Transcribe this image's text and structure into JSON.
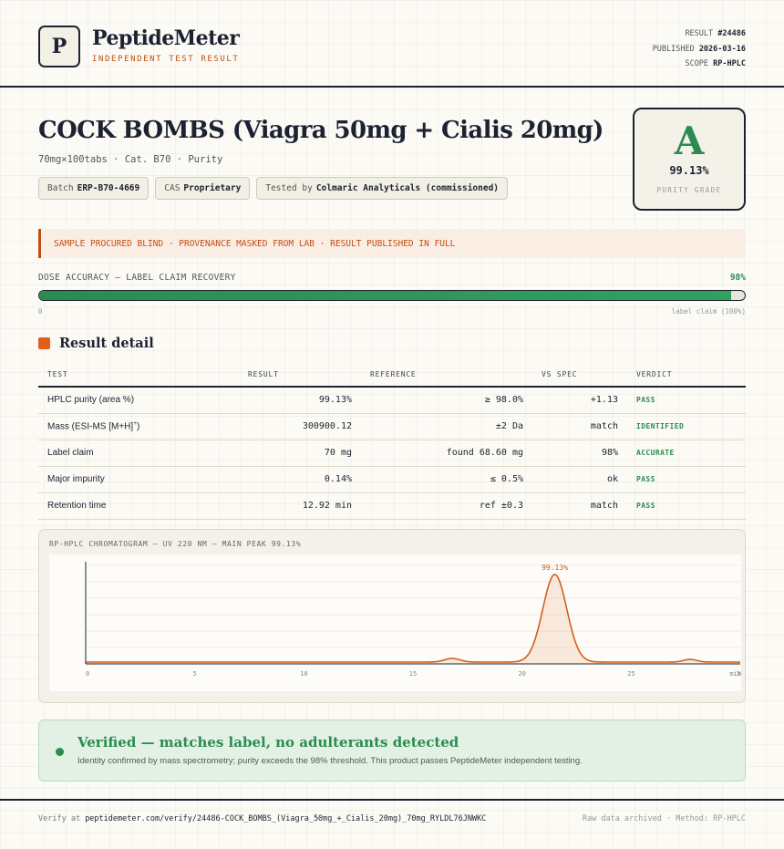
{
  "header": {
    "logo_letter": "P",
    "brand": "PeptideMeter",
    "brand_sub": "INDEPENDENT TEST RESULT",
    "result_label": "RESULT",
    "result_value": "#24486",
    "published_label": "PUBLISHED",
    "published_value": "2026-03-16",
    "scope_label": "SCOPE",
    "scope_value": "RP-HPLC"
  },
  "product": {
    "title": "COCK BOMBS (Viagra 50mg + Cialis 20mg)",
    "subtitle": "70mg×100tabs · Cat. B70 · Purity",
    "chips": [
      {
        "label": "Batch",
        "value": "ERP-B70-4669"
      },
      {
        "label": "CAS",
        "value": "Proprietary"
      },
      {
        "label": "Tested by",
        "value": "Colmaric Analyticals (commissioned)"
      }
    ]
  },
  "grade": {
    "letter": "A",
    "percent": "99.13%",
    "label": "PURITY GRADE"
  },
  "notice": "SAMPLE PROCURED BLIND · PROVENANCE MASKED FROM LAB · RESULT PUBLISHED IN FULL",
  "dose": {
    "label": "DOSE ACCURACY — LABEL CLAIM RECOVERY",
    "value_text": "98%",
    "fraction": 0.98,
    "min_label": "0",
    "max_label": "label claim (100%)"
  },
  "results": {
    "section_title": "Result detail",
    "headers": [
      "TEST",
      "RESULT",
      "REFERENCE",
      "VS SPEC",
      "VERDICT"
    ],
    "rows": [
      {
        "test": "HPLC purity (area %)",
        "result": "99.13%",
        "reference": "≥ 98.0%",
        "vs_spec": "+1.13",
        "verdict": "PASS"
      },
      {
        "test": "Mass (ESI-MS [M+H]",
        "test_sup": "+",
        "test_end": ")",
        "result": "300900.12",
        "reference": "±2 Da",
        "vs_spec": "match",
        "verdict": "IDENTIFIED"
      },
      {
        "test": "Label claim",
        "result": "70 mg",
        "reference": "found 68.60 mg",
        "vs_spec": "98%",
        "verdict": "ACCURATE"
      },
      {
        "test": "Major impurity",
        "result": "0.14%",
        "reference": "≤ 0.5%",
        "vs_spec": "ok",
        "verdict": "PASS"
      },
      {
        "test": "Retention time",
        "result": "12.92 min",
        "reference": "ref ±0.3",
        "vs_spec": "match",
        "verdict": "PASS"
      }
    ]
  },
  "chromatogram": {
    "title": "RP-HPLC CHROMATOGRAM — UV 220 NM — MAIN PEAK 99.13%",
    "peak_label": "99.13%",
    "accent": "#d4601a"
  },
  "chart_data": {
    "type": "line",
    "title": "RP-HPLC CHROMATOGRAM — UV 220 NM — MAIN PEAK 99.13%",
    "x_ticks": [
      "0",
      "5",
      "10",
      "15",
      "20",
      "25",
      "30"
    ],
    "x_end_label": "min",
    "xlim": [
      0,
      30
    ],
    "series": [
      {
        "x": [
          0,
          16,
          16.8,
          17.6,
          19.5,
          20.3,
          21.0,
          21.5,
          22.0,
          22.7,
          23.5,
          27.0,
          27.7,
          28.4,
          30
        ],
        "y": [
          0.02,
          0.02,
          0.06,
          0.02,
          0.02,
          0.2,
          0.75,
          0.98,
          0.75,
          0.2,
          0.02,
          0.02,
          0.05,
          0.02,
          0.02
        ]
      }
    ],
    "peak_annotation": "99.13%"
  },
  "verified": {
    "title": "Verified — matches label, no adulterants detected",
    "text": "Identity confirmed by mass spectrometry; purity exceeds the 98% threshold. This product passes PeptideMeter independent testing."
  },
  "footer": {
    "verify_prefix": "Verify at",
    "verify_url": "peptidemeter.com/verify/24486-COCK_BOMBS_(Viagra_50mg_+_Cialis_20mg)_70mg_RYLDL76JNWKC",
    "right_text": "Raw data archived · Method: RP-HPLC"
  }
}
